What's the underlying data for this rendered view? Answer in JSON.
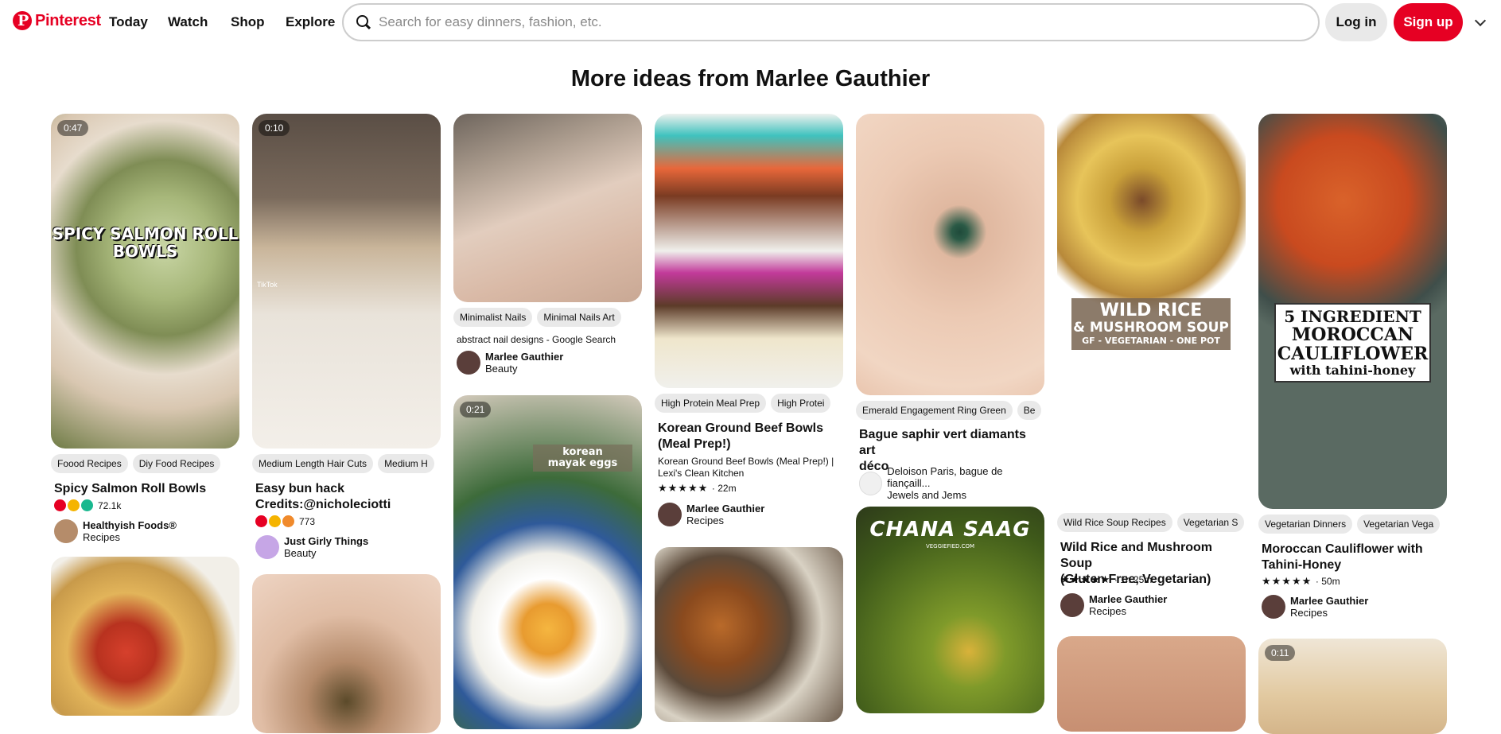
{
  "header": {
    "logo_text": "Pinterest",
    "nav": [
      "Today",
      "Watch",
      "Shop",
      "Explore"
    ],
    "search_placeholder": "Search for easy dinners, fashion, etc.",
    "login_label": "Log in",
    "signup_label": "Sign up",
    "brand_color": "#e60023"
  },
  "page_title": "More ideas from Marlee Gauthier",
  "pins": [
    {
      "duration": "0:47",
      "overlay_lines": [
        "SPICY SALMON ROLL",
        "BOWLS"
      ],
      "chips": [
        "Foood Recipes",
        "Diy Food Recipes"
      ],
      "title": "Spicy Salmon Roll Bowls",
      "reaction_count": "72.1k",
      "creator": "Healthyish Foods®",
      "category": "Recipes"
    },
    {
      "duration": "0:10",
      "watermark": "TikTok",
      "chips": [
        "Medium Length Hair Cuts",
        "Medium H"
      ],
      "title_lines": [
        "Easy bun hack",
        "Credits:@nicholeciotti"
      ],
      "reaction_count": "773",
      "creator": "Just Girly Things",
      "category": "Beauty"
    },
    {
      "chips": [
        "Minimalist Nails",
        "Minimal Nails Art"
      ],
      "description": "abstract nail designs - Google Search",
      "creator": "Marlee Gauthier",
      "category": "Beauty"
    },
    {
      "duration": "0:21",
      "overlay_lines": [
        "korean",
        "mayak eggs"
      ]
    },
    {
      "chips": [
        "High Protein Meal Prep",
        "High Protei"
      ],
      "title_lines": [
        "Korean Ground Beef Bowls",
        "(Meal Prep!)"
      ],
      "description_lines": [
        "Korean Ground Beef Bowls (Meal Prep!) |",
        "Lexi's Clean Kitchen"
      ],
      "rating": "★★★★★",
      "time": "· 22m",
      "creator": "Marlee Gauthier",
      "category": "Recipes"
    },
    {
      "chips": [
        "Emerald Engagement Ring Green",
        "Be"
      ],
      "title_lines": [
        "Bague saphir vert diamants art",
        "déco"
      ],
      "creator": "Deloison Paris, bague de fiançaill...",
      "category": "Jewels and Jems"
    },
    {
      "overlay_lines": [
        "CHANA SAAG"
      ],
      "watermark": "VEGGIEFIED.COM"
    },
    {
      "overlay_lines": [
        "WILD RICE",
        "& MUSHROOM SOUP",
        "GF - VEGETARIAN - ONE POT"
      ],
      "chips": [
        "Wild Rice Soup Recipes",
        "Vegetarian S"
      ],
      "title_lines": [
        "Wild Rice and Mushroom Soup",
        "(Gluten Free, Vegetarian)"
      ],
      "rating": "★★★★★",
      "time": "· 1h 25m",
      "creator": "Marlee Gauthier",
      "category": "Recipes"
    },
    {
      "overlay_lines": [
        "5 INGREDIENT",
        "MOROCCAN",
        "CAULIFLOWER",
        "with tahini-honey"
      ],
      "chips": [
        "Vegetarian Dinners",
        "Vegetarian Vega"
      ],
      "title_lines": [
        "Moroccan Cauliflower with",
        "Tahini-Honey"
      ],
      "rating": "★★★★★",
      "time": "· 50m",
      "creator": "Marlee Gauthier",
      "category": "Recipes"
    },
    {
      "duration": "0:11"
    }
  ],
  "icons": {
    "search": "search-icon",
    "more": "chevron-down-icon",
    "chip_more": "chevron-right-icon"
  }
}
